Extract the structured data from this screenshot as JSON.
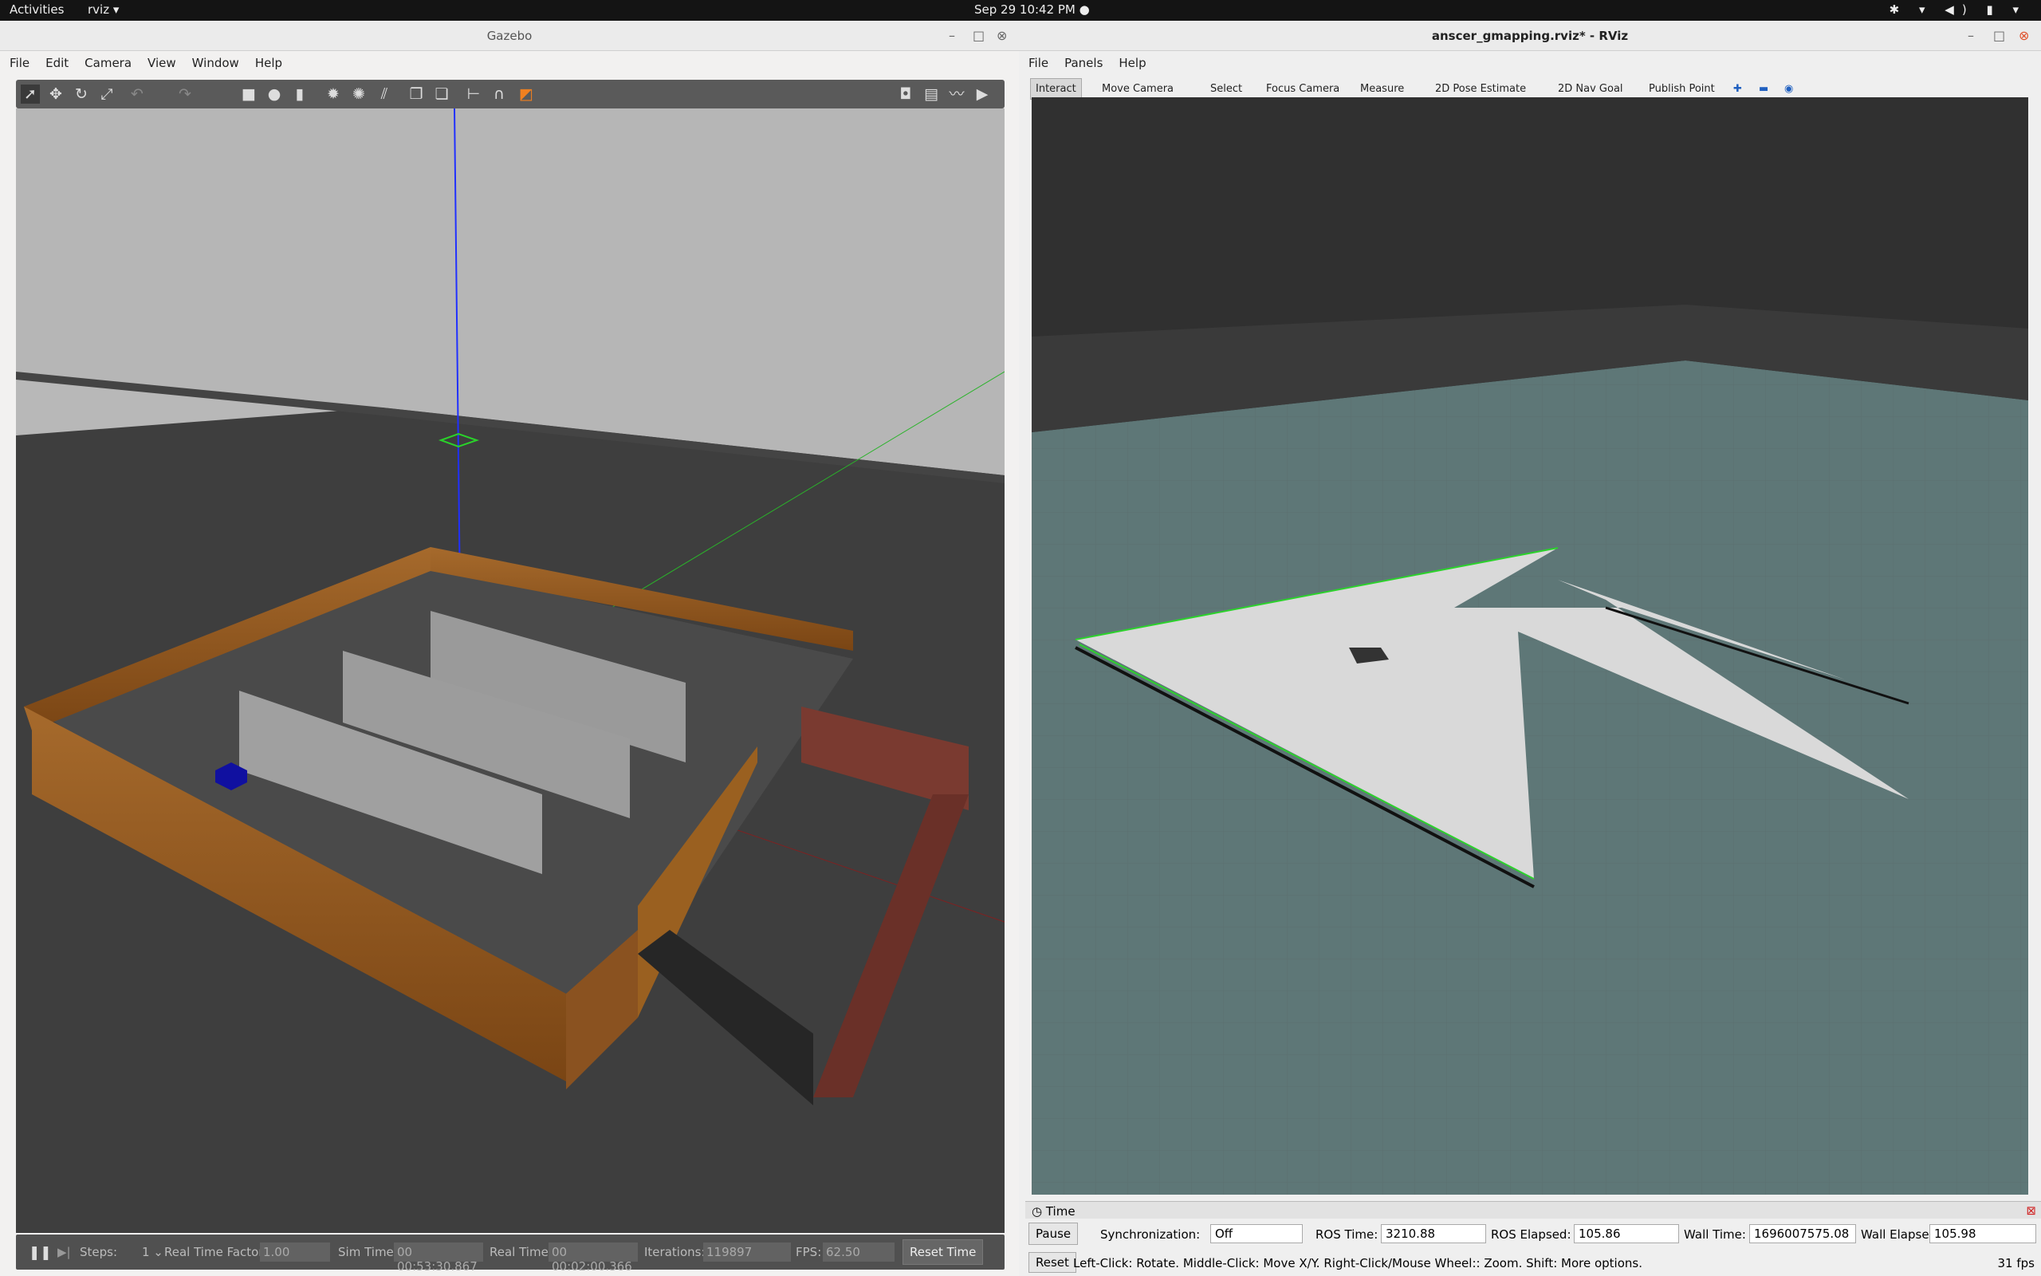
{
  "topbar": {
    "activities": "Activities",
    "app": "rviz ▾",
    "clock": "Sep 29  10:42 PM  ●",
    "tray": "✱ ▾ ◀) ▮ ▾"
  },
  "gazebo": {
    "title": "Gazebo",
    "menu": [
      "File",
      "Edit",
      "Camera",
      "View",
      "Window",
      "Help"
    ],
    "bottom": {
      "steps_label": "Steps:",
      "steps_value": "1 ⌄",
      "rtf_label": "Real Time Factor:",
      "rtf_value": "1.00",
      "sim_label": "Sim Time:",
      "sim_value": "00 00:53:30.867",
      "real_label": "Real Time:",
      "real_value": "00 00:02:00.366",
      "iter_label": "Iterations:",
      "iter_value": "119897",
      "fps_label": "FPS:",
      "fps_value": "62.50",
      "reset": "Reset Time"
    }
  },
  "rviz": {
    "title": "anscer_gmapping.rviz* - RViz",
    "menu": [
      "File",
      "Panels",
      "Help"
    ],
    "tools": [
      "Interact",
      "Move Camera",
      "Select",
      "Focus Camera",
      "Measure",
      "2D Pose Estimate",
      "2D Nav Goal",
      "Publish Point"
    ],
    "time_panel": "Time",
    "pause": "Pause",
    "sync_label": "Synchronization:",
    "sync_value": "Off",
    "ros_time_label": "ROS Time:",
    "ros_time": "3210.88",
    "ros_elapsed_label": "ROS Elapsed:",
    "ros_elapsed": "105.86",
    "wall_time_label": "Wall Time:",
    "wall_time": "1696007575.08",
    "wall_elapsed_label": "Wall Elapsed:",
    "wall_elapsed": "105.98",
    "reset": "Reset",
    "hint": "Left-Click: Rotate. Middle-Click: Move X/Y. Right-Click/Mouse Wheel:: Zoom. Shift: More options.",
    "fps": "31 fps"
  }
}
